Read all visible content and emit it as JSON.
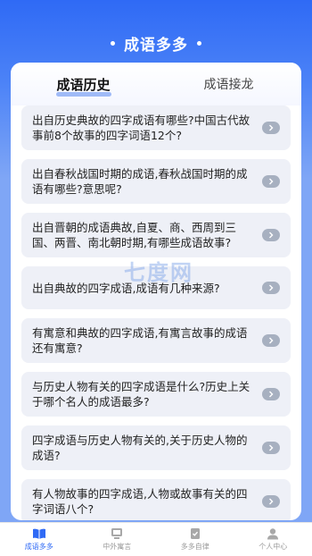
{
  "header": {
    "title": "成语多多"
  },
  "tabs": [
    {
      "label": "成语历史",
      "active": true
    },
    {
      "label": "成语接龙",
      "active": false
    }
  ],
  "items": [
    {
      "text": "出自历史典故的四字成语有哪些?中国古代故事前8个故事的四字词语12个?"
    },
    {
      "text": "出自春秋战国时期的成语,春秋战国时期的成语有哪些?意思呢?"
    },
    {
      "text": "出自晋朝的成语典故,自夏、商、西周到三国、两晋、南北朝时期,有哪些成语故事?"
    },
    {
      "text": "出自典故的四字成语,成语有几种来源?"
    },
    {
      "text": "有寓意和典故的四字成语,有寓言故事的成语还有寓意?"
    },
    {
      "text": "与历史人物有关的四字成语是什么?历史上关于哪个名人的成语最多?"
    },
    {
      "text": "四字成语与历史人物有关的,关于历史人物的成语?"
    },
    {
      "text": "有人物故事的四字成语,人物或故事有关的四字词语八个?"
    }
  ],
  "watermark": "七度网",
  "bottom_nav": [
    {
      "label": "成语多多",
      "icon": "book-icon",
      "active": true
    },
    {
      "label": "中外寓言",
      "icon": "monitor-icon",
      "active": false
    },
    {
      "label": "多多自律",
      "icon": "clipboard-icon",
      "active": false
    },
    {
      "label": "个人中心",
      "icon": "user-icon",
      "active": false
    }
  ],
  "colors": {
    "primary": "#2f6af5",
    "item_bg": "#eef0f7"
  }
}
